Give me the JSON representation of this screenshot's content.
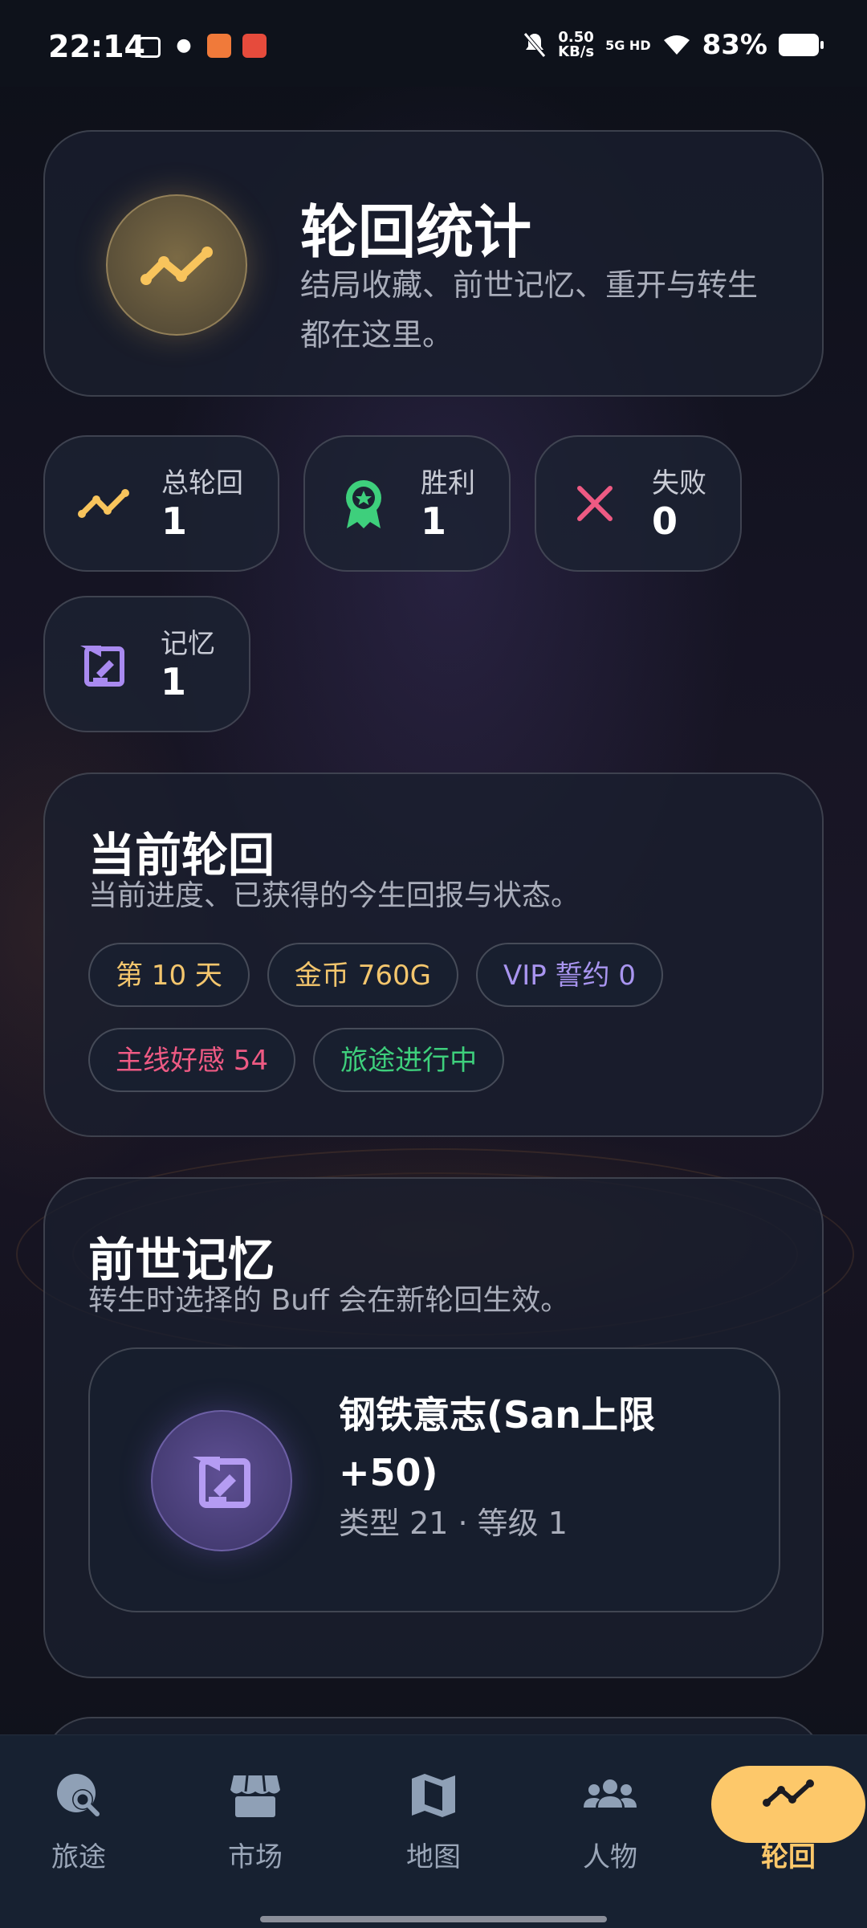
{
  "status_bar": {
    "time": "22:14",
    "net_speed_value": "0.50",
    "net_speed_unit": "KB/s",
    "signal": "5G HD",
    "battery": "83%"
  },
  "header_card": {
    "title": "轮回统计",
    "subtitle": "结局收藏、前世记忆、重开与转生都在这里。",
    "icon": "trend-line-icon"
  },
  "stats": [
    {
      "label": "总轮回",
      "value": "1",
      "icon": "trend-line-icon",
      "color": "#f8c45c"
    },
    {
      "label": "胜利",
      "value": "1",
      "icon": "award-ribbon-icon",
      "color": "#3ecf7c"
    },
    {
      "label": "失败",
      "value": "0",
      "icon": "close-x-icon",
      "color": "#ee5a83"
    },
    {
      "label": "记忆",
      "value": "1",
      "icon": "memory-scroll-icon",
      "color": "#a98af0"
    }
  ],
  "current_cycle": {
    "title": "当前轮回",
    "subtitle": "当前进度、已获得的今生回报与状态。",
    "chips": [
      {
        "label": "第 10 天",
        "color": "#f4c66d"
      },
      {
        "label": "金币 760G",
        "color": "#f4c66d"
      },
      {
        "label": "VIP 誓约 0",
        "color": "#a995f0"
      },
      {
        "label": "主线好感 54",
        "color": "#ee5a83"
      },
      {
        "label": "旅途进行中",
        "color": "#3ecf7c"
      }
    ]
  },
  "past_memory": {
    "title": "前世记忆",
    "subtitle": "转生时选择的 Buff 会在新轮回生效。",
    "item": {
      "name_line1": "钢铁意志(San上限",
      "name_line2": "+50)",
      "meta": "类型 21 · 等级 1"
    }
  },
  "nav": {
    "items": [
      {
        "label": "旅途",
        "icon": "globe-search-icon"
      },
      {
        "label": "市场",
        "icon": "storefront-icon"
      },
      {
        "label": "地图",
        "icon": "map-icon"
      },
      {
        "label": "人物",
        "icon": "people-group-icon"
      },
      {
        "label": "轮回",
        "icon": "trend-line-icon"
      }
    ],
    "active_index": 4,
    "active_color": "#fdc86a"
  }
}
